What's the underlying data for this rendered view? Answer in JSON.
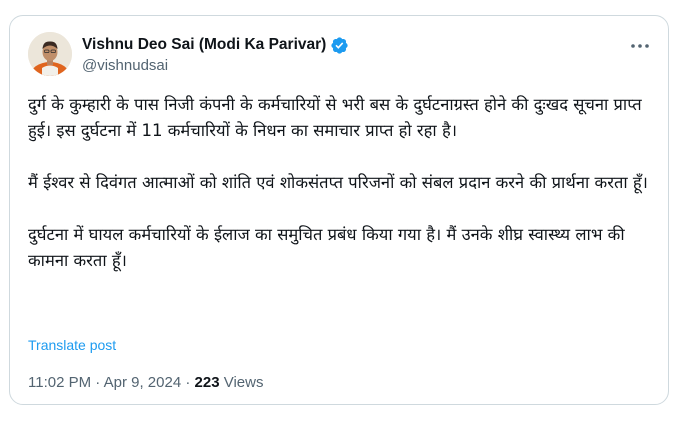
{
  "author": {
    "display_name": "Vishnu Deo Sai (Modi Ka Parivar)",
    "handle": "@vishnudsai",
    "verified_icon": "verified-badge-icon",
    "verified_color": "#1d9bf0"
  },
  "more_icon": "more-options-icon",
  "tweet": {
    "paragraphs": [
      "दुर्ग के कुम्हारी के पास निजी कंपनी के कर्मचारियों से भरी बस के दुर्घटनाग्रस्त होने की दुःखद सूचना प्राप्त हुई। इस दुर्घटना में 11 कर्मचारियों के निधन का समाचार प्राप्त हो रहा है।",
      "मैं ईश्वर से दिवंगत आत्माओं को शांति एवं शोकसंतप्त परिजनों को संबल प्रदान करने की प्रार्थना करता हूँ।",
      "दुर्घटना में घायल कर्मचारियों के ईलाज का समुचित प्रबंध किया गया है। मैं उनके शीघ्र स्वास्थ्य लाभ की कामना करता हूँ।"
    ],
    "translate_label": "Translate post"
  },
  "meta": {
    "time": "11:02 PM",
    "separator": " · ",
    "date": "Apr 9, 2024",
    "views_count": "223",
    "views_label": " Views"
  },
  "colors": {
    "text": "#0f1419",
    "secondary": "#536471",
    "link": "#1d9bf0",
    "border": "#cfd9de"
  }
}
